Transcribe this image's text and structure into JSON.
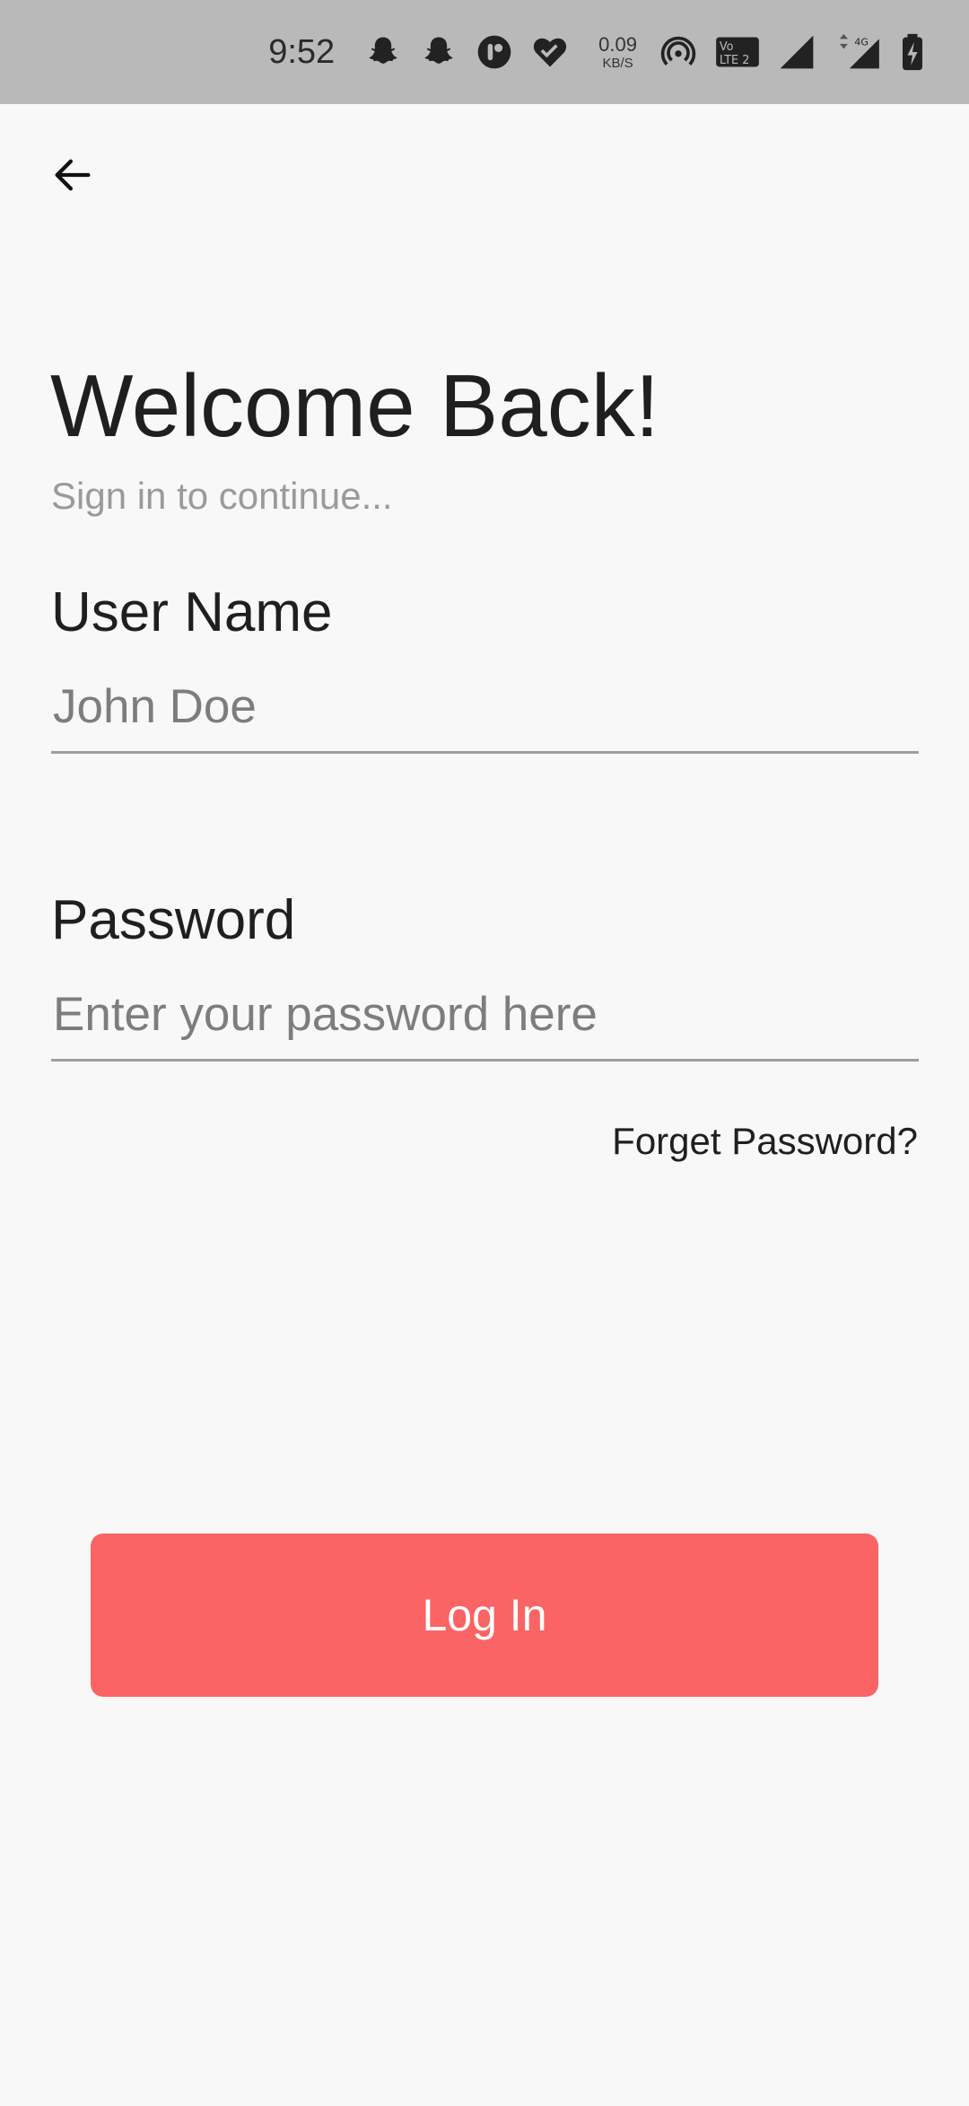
{
  "status_bar": {
    "time": "9:52",
    "net_speed_value": "0.09",
    "net_speed_unit": "KB/S",
    "icons": [
      "snapchat-icon",
      "snapchat-icon",
      "app-icon",
      "heart-check-icon",
      "hotspot-icon",
      "volte-icon",
      "signal-icon",
      "signal-4g-icon",
      "battery-charging-icon"
    ]
  },
  "header": {
    "back_icon": "arrow-left-icon"
  },
  "main": {
    "title": "Welcome Back!",
    "subtitle": "Sign in to continue...",
    "username": {
      "label": "User Name",
      "placeholder": "John Doe",
      "value": ""
    },
    "password": {
      "label": "Password",
      "placeholder": "Enter your password here",
      "value": ""
    },
    "forgot_password": "Forget Password?",
    "login_label": "Log In"
  },
  "colors": {
    "accent": "#fa6464",
    "status_bar": "#b9b9b9",
    "background": "#f8f8f8"
  }
}
